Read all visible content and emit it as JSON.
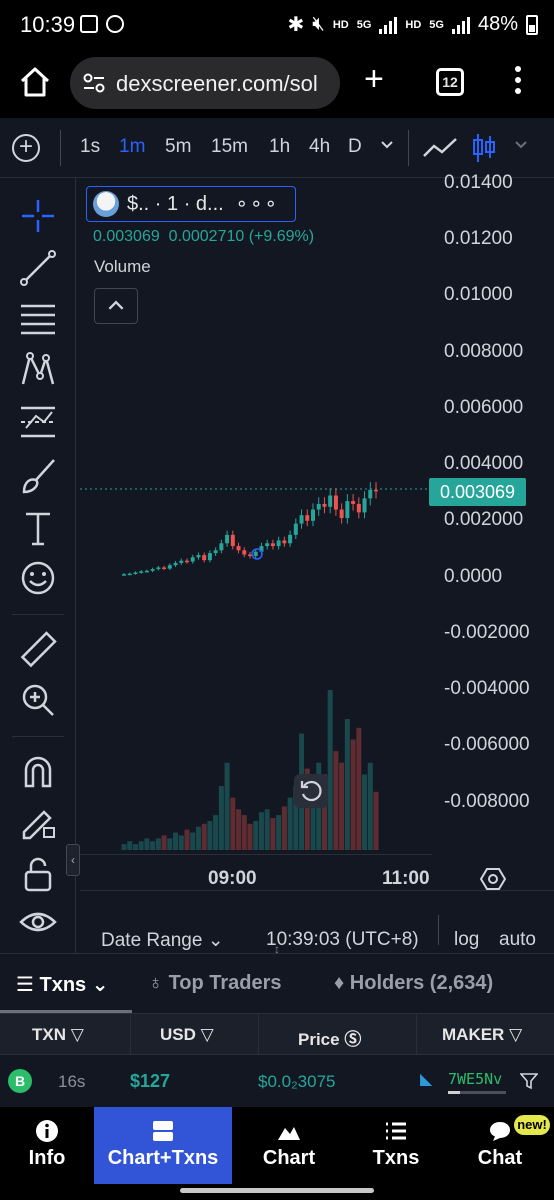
{
  "status_bar": {
    "time": "10:39",
    "net_hd_1": "HD",
    "net_5g_1": "5G",
    "net_hd_2": "HD",
    "net_5g_2": "5G",
    "battery": "48%"
  },
  "browser": {
    "url": "dexscreener.com/sol",
    "tab_count": "12"
  },
  "chart_toolbar": {
    "intervals": [
      "1s",
      "1m",
      "5m",
      "15m",
      "1h",
      "4h",
      "D"
    ],
    "active_interval": "1m"
  },
  "legend": {
    "symbol": "$.. · 1 · d...",
    "more": "∘∘∘",
    "ohlc": "0.003069  0.0002710 (+9.69%)",
    "volume_label": "Volume"
  },
  "y_axis": {
    "ticks": [
      "0.01400",
      "0.01200",
      "0.01000",
      "0.008000",
      "0.006000",
      "0.004000",
      "0.002000",
      "0.0000",
      "-0.002000",
      "-0.004000",
      "-0.006000",
      "-0.008000"
    ],
    "last_price": "0.003069"
  },
  "x_axis": {
    "ticks": [
      "09:00",
      "11:00"
    ]
  },
  "chart_bottom": {
    "date_range": "Date Range",
    "clock": "10:39:03 (UTC+8)",
    "log": "log",
    "auto": "auto"
  },
  "colors": {
    "up": "#26a69a",
    "down": "#ef5350",
    "accent": "#2962ff",
    "nav_active": "#3254d6",
    "buy": "#2bbd69"
  },
  "tabs": {
    "txns": "Txns",
    "top_traders": "Top Traders",
    "holders": "Holders (2,634)"
  },
  "table": {
    "headers": [
      "TXN",
      "USD",
      "Price",
      "MAKER"
    ],
    "rows": [
      {
        "type": "B",
        "age": "16s",
        "usd": "$127",
        "price": "$0.0₂3075",
        "maker": "7WE5Nv"
      }
    ]
  },
  "bottom_nav": {
    "items": [
      "Info",
      "Chart+Txns",
      "Chart",
      "Txns",
      "Chat"
    ],
    "active": "Chart+Txns",
    "new_badge": "new!"
  },
  "chart_data": {
    "type": "candlestick",
    "x_ticks": [
      "09:00",
      "11:00"
    ],
    "y_range": [
      -0.009,
      0.0145
    ],
    "last_price": 0.003069,
    "price_series": [
      0.0001,
      0.00012,
      0.00016,
      0.0002,
      0.00022,
      0.00028,
      0.00034,
      0.0003,
      0.00042,
      0.0005,
      0.00058,
      0.00055,
      0.0007,
      0.00078,
      0.0006,
      0.00085,
      0.00095,
      0.0012,
      0.0015,
      0.0011,
      0.00095,
      0.0008,
      0.00075,
      0.0009,
      0.0011,
      0.0012,
      0.0011,
      0.0013,
      0.0012,
      0.0015,
      0.0019,
      0.0022,
      0.002,
      0.0024,
      0.0026,
      0.0025,
      0.0029,
      0.0024,
      0.0021,
      0.0027,
      0.0026,
      0.0023,
      0.0028,
      0.0031,
      0.003069
    ],
    "volume_series": [
      2,
      3,
      2,
      3,
      4,
      3,
      4,
      5,
      4,
      6,
      5,
      7,
      6,
      8,
      9,
      10,
      12,
      22,
      30,
      18,
      14,
      12,
      9,
      10,
      13,
      14,
      11,
      12,
      15,
      18,
      22,
      40,
      28,
      24,
      30,
      26,
      55,
      34,
      30,
      45,
      38,
      42,
      26,
      30,
      20
    ]
  }
}
